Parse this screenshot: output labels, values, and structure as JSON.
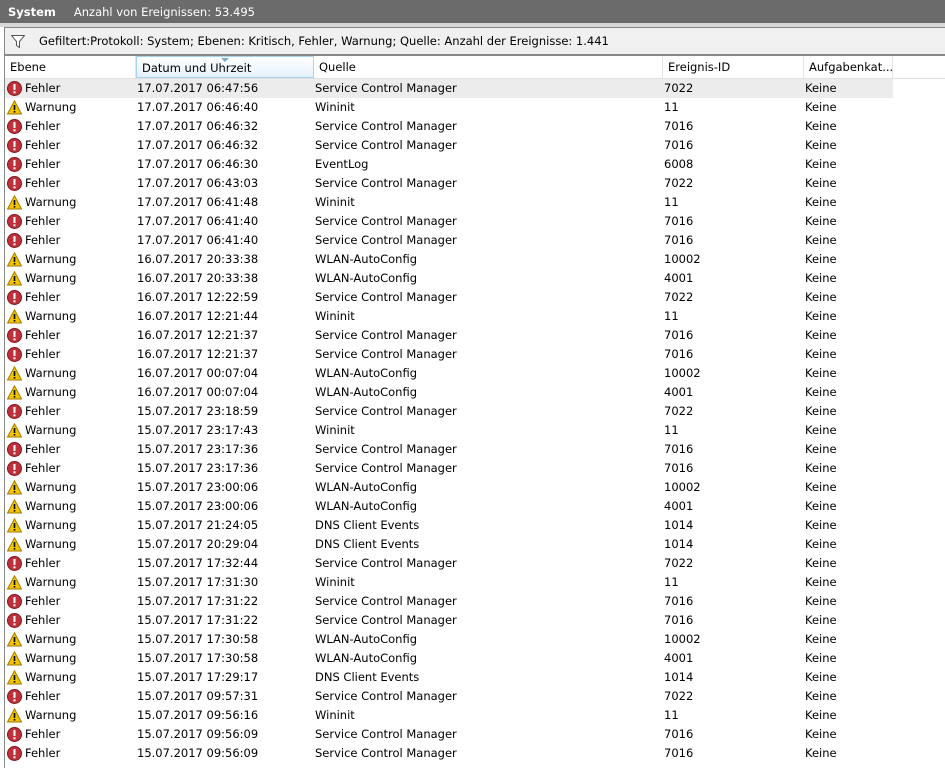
{
  "title": {
    "name": "System",
    "count": "Anzahl von Ereignissen: 53.495"
  },
  "filter": {
    "icon": "filter-icon",
    "text": "Gefiltert:Protokoll: System; Ebenen: Kritisch, Fehler, Warnung; Quelle:  Anzahl der Ereignisse: 1.441"
  },
  "columns": [
    "Ebene",
    "Datum und Uhrzeit",
    "Quelle",
    "Ereignis-ID",
    "Aufgabenkat..."
  ],
  "colors": {
    "error": "#c0303a",
    "warning": "#f5c400"
  },
  "rows": [
    [
      "Fehler",
      "17.07.2017 06:47:56",
      "Service Control Manager",
      "7022",
      "Keine"
    ],
    [
      "Warnung",
      "17.07.2017 06:46:40",
      "Wininit",
      "11",
      "Keine"
    ],
    [
      "Fehler",
      "17.07.2017 06:46:32",
      "Service Control Manager",
      "7016",
      "Keine"
    ],
    [
      "Fehler",
      "17.07.2017 06:46:32",
      "Service Control Manager",
      "7016",
      "Keine"
    ],
    [
      "Fehler",
      "17.07.2017 06:46:30",
      "EventLog",
      "6008",
      "Keine"
    ],
    [
      "Fehler",
      "17.07.2017 06:43:03",
      "Service Control Manager",
      "7022",
      "Keine"
    ],
    [
      "Warnung",
      "17.07.2017 06:41:48",
      "Wininit",
      "11",
      "Keine"
    ],
    [
      "Fehler",
      "17.07.2017 06:41:40",
      "Service Control Manager",
      "7016",
      "Keine"
    ],
    [
      "Fehler",
      "17.07.2017 06:41:40",
      "Service Control Manager",
      "7016",
      "Keine"
    ],
    [
      "Warnung",
      "16.07.2017 20:33:38",
      "WLAN-AutoConfig",
      "10002",
      "Keine"
    ],
    [
      "Warnung",
      "16.07.2017 20:33:38",
      "WLAN-AutoConfig",
      "4001",
      "Keine"
    ],
    [
      "Fehler",
      "16.07.2017 12:22:59",
      "Service Control Manager",
      "7022",
      "Keine"
    ],
    [
      "Warnung",
      "16.07.2017 12:21:44",
      "Wininit",
      "11",
      "Keine"
    ],
    [
      "Fehler",
      "16.07.2017 12:21:37",
      "Service Control Manager",
      "7016",
      "Keine"
    ],
    [
      "Fehler",
      "16.07.2017 12:21:37",
      "Service Control Manager",
      "7016",
      "Keine"
    ],
    [
      "Warnung",
      "16.07.2017 00:07:04",
      "WLAN-AutoConfig",
      "10002",
      "Keine"
    ],
    [
      "Warnung",
      "16.07.2017 00:07:04",
      "WLAN-AutoConfig",
      "4001",
      "Keine"
    ],
    [
      "Fehler",
      "15.07.2017 23:18:59",
      "Service Control Manager",
      "7022",
      "Keine"
    ],
    [
      "Warnung",
      "15.07.2017 23:17:43",
      "Wininit",
      "11",
      "Keine"
    ],
    [
      "Fehler",
      "15.07.2017 23:17:36",
      "Service Control Manager",
      "7016",
      "Keine"
    ],
    [
      "Fehler",
      "15.07.2017 23:17:36",
      "Service Control Manager",
      "7016",
      "Keine"
    ],
    [
      "Warnung",
      "15.07.2017 23:00:06",
      "WLAN-AutoConfig",
      "10002",
      "Keine"
    ],
    [
      "Warnung",
      "15.07.2017 23:00:06",
      "WLAN-AutoConfig",
      "4001",
      "Keine"
    ],
    [
      "Warnung",
      "15.07.2017 21:24:05",
      "DNS Client Events",
      "1014",
      "Keine"
    ],
    [
      "Warnung",
      "15.07.2017 20:29:04",
      "DNS Client Events",
      "1014",
      "Keine"
    ],
    [
      "Fehler",
      "15.07.2017 17:32:44",
      "Service Control Manager",
      "7022",
      "Keine"
    ],
    [
      "Warnung",
      "15.07.2017 17:31:30",
      "Wininit",
      "11",
      "Keine"
    ],
    [
      "Fehler",
      "15.07.2017 17:31:22",
      "Service Control Manager",
      "7016",
      "Keine"
    ],
    [
      "Fehler",
      "15.07.2017 17:31:22",
      "Service Control Manager",
      "7016",
      "Keine"
    ],
    [
      "Warnung",
      "15.07.2017 17:30:58",
      "WLAN-AutoConfig",
      "10002",
      "Keine"
    ],
    [
      "Warnung",
      "15.07.2017 17:30:58",
      "WLAN-AutoConfig",
      "4001",
      "Keine"
    ],
    [
      "Warnung",
      "15.07.2017 17:29:17",
      "DNS Client Events",
      "1014",
      "Keine"
    ],
    [
      "Fehler",
      "15.07.2017 09:57:31",
      "Service Control Manager",
      "7022",
      "Keine"
    ],
    [
      "Warnung",
      "15.07.2017 09:56:16",
      "Wininit",
      "11",
      "Keine"
    ],
    [
      "Fehler",
      "15.07.2017 09:56:09",
      "Service Control Manager",
      "7016",
      "Keine"
    ],
    [
      "Fehler",
      "15.07.2017 09:56:09",
      "Service Control Manager",
      "7016",
      "Keine"
    ]
  ]
}
